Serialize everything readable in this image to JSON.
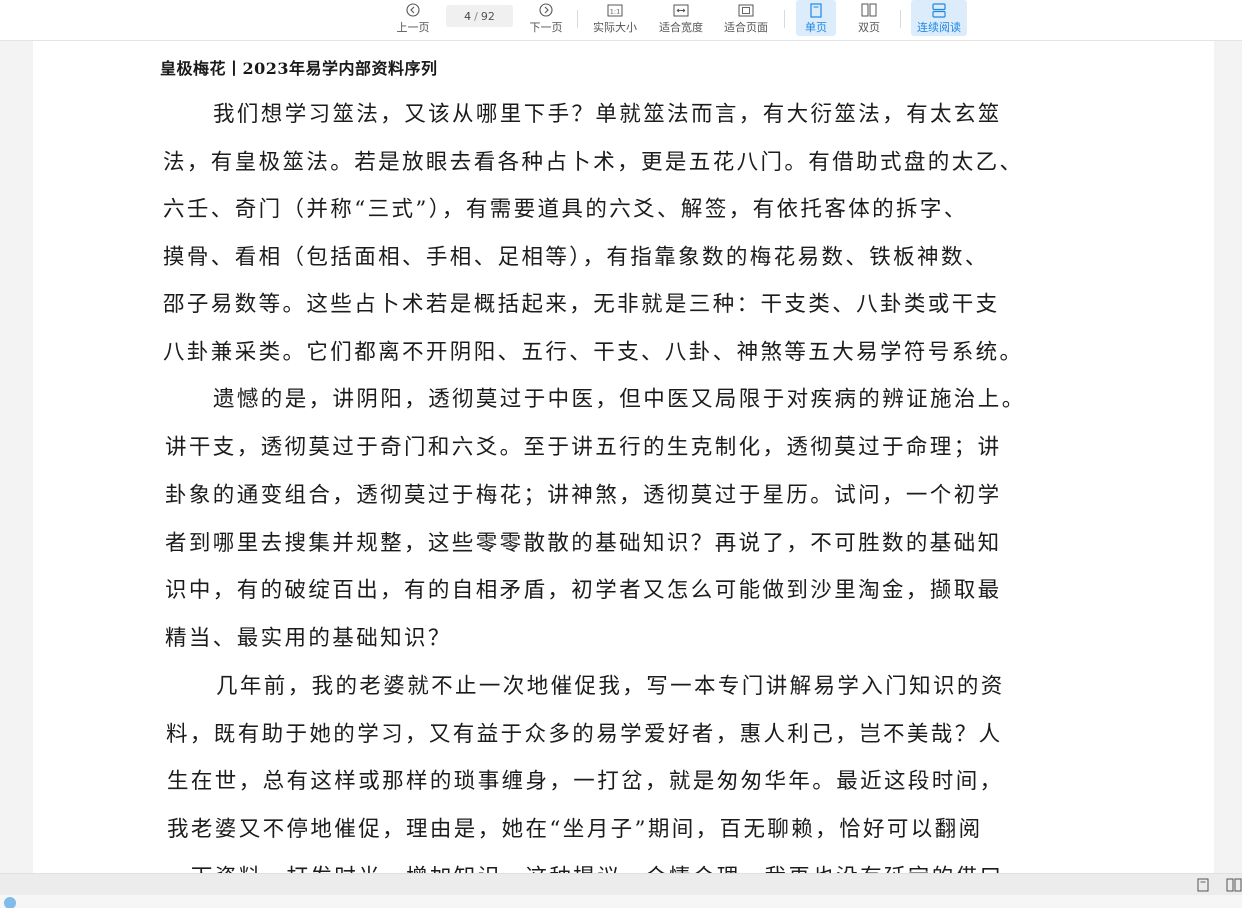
{
  "toolbar": {
    "prev_label": "上一页",
    "next_label": "下一页",
    "current_page": "4",
    "separator": "/",
    "total_pages": "92",
    "actual_size_label": "实际大小",
    "fit_width_label": "适合宽度",
    "fit_page_label": "适合页面",
    "single_page_label": "单页",
    "double_page_label": "双页",
    "continuous_label": "连续阅读",
    "active_color": "#1e88e5",
    "icons": {
      "prev": "circle-arrow-left-icon",
      "next": "circle-arrow-right-icon",
      "actual_size": "actual-size-icon",
      "fit_width": "fit-width-icon",
      "fit_page": "fit-page-icon",
      "single_page": "single-page-icon",
      "double_page": "double-page-icon",
      "continuous": "continuous-scroll-icon"
    }
  },
  "document": {
    "header": "皇极梅花丨2023年易学内部资料序列",
    "lines": [
      "我们想学习筮法，又该从哪里下手？单就筮法而言，有大衍筮法，有太玄筮",
      "法，有皇极筮法。若是放眼去看各种占卜术，更是五花八门。有借助式盘的太乙、",
      "六壬、奇门（并称“三式”），有需要道具的六爻、解签，有依托客体的拆字、",
      "摸骨、看相（包括面相、手相、足相等），有指靠象数的梅花易数、铁板神数、",
      "邵子易数等。这些占卜术若是概括起来，无非就是三种：干支类、八卦类或干支",
      "八卦兼采类。它们都离不开阴阳、五行、干支、八卦、神煞等五大易学符号系统。",
      "遗憾的是，讲阴阳，透彻莫过于中医，但中医又局限于对疾病的辨证施治上。",
      "讲干支，透彻莫过于奇门和六爻。至于讲五行的生克制化，透彻莫过于命理；讲",
      "卦象的通变组合，透彻莫过于梅花；讲神煞，透彻莫过于星历。试问，一个初学",
      "者到哪里去搜集并规整，这些零零散散的基础知识？再说了，不可胜数的基础知",
      "识中，有的破绽百出，有的自相矛盾，初学者又怎么可能做到沙里淘金，撷取最",
      "精当、最实用的基础知识？",
      "几年前，我的老婆就不止一次地催促我，写一本专门讲解易学入门知识的资",
      "料，既有助于她的学习，又有益于众多的易学爱好者，惠人利己，岂不美哉？人",
      "生在世，总有这样或那样的琐事缠身，一打岔，就是匆匆华年。最近这段时间，",
      "我老婆又不停地催促，理由是，她在“坐月子”期间，百无聊赖，恰好可以翻阅",
      "一下资料，打发时光，增加知识。这种提议，合情合理，我再也没有延宕的借口"
    ]
  },
  "bottom_bar": {
    "icons": [
      "single-page-view-icon",
      "double-page-view-icon"
    ]
  }
}
